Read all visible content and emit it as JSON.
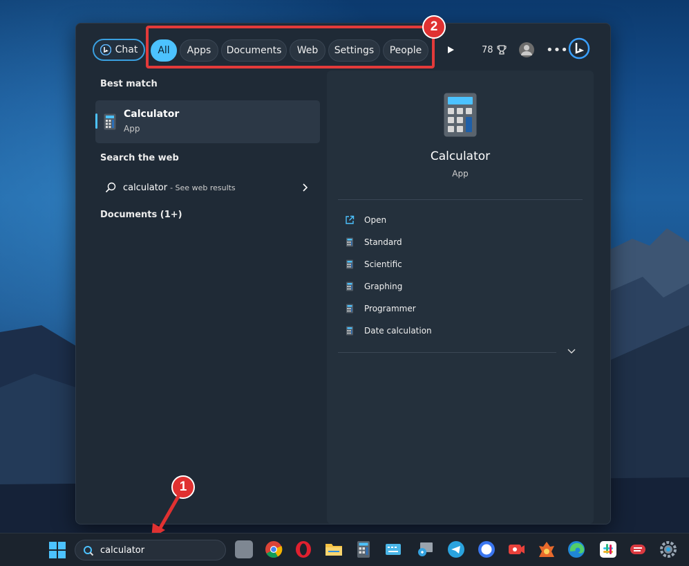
{
  "header": {
    "chat_label": "Chat",
    "filters": [
      "All",
      "Apps",
      "Documents",
      "Web",
      "Settings",
      "People"
    ],
    "points": "78"
  },
  "annotations": {
    "badge_1": "1",
    "badge_2": "2"
  },
  "left": {
    "best_match_heading": "Best match",
    "best_match": {
      "name": "Calculator",
      "type": "App"
    },
    "search_web_heading": "Search the web",
    "web_result": {
      "query": "calculator",
      "hint": "- See web results"
    },
    "documents_heading": "Documents (1+)"
  },
  "details": {
    "app_name": "Calculator",
    "app_type": "App",
    "actions": [
      "Open",
      "Standard",
      "Scientific",
      "Graphing",
      "Programmer",
      "Date calculation"
    ]
  },
  "taskbar": {
    "search_value": "calculator"
  },
  "colors": {
    "accent": "#4cc2ff",
    "highlight": "#e33a3a",
    "badge": "#e03131"
  }
}
